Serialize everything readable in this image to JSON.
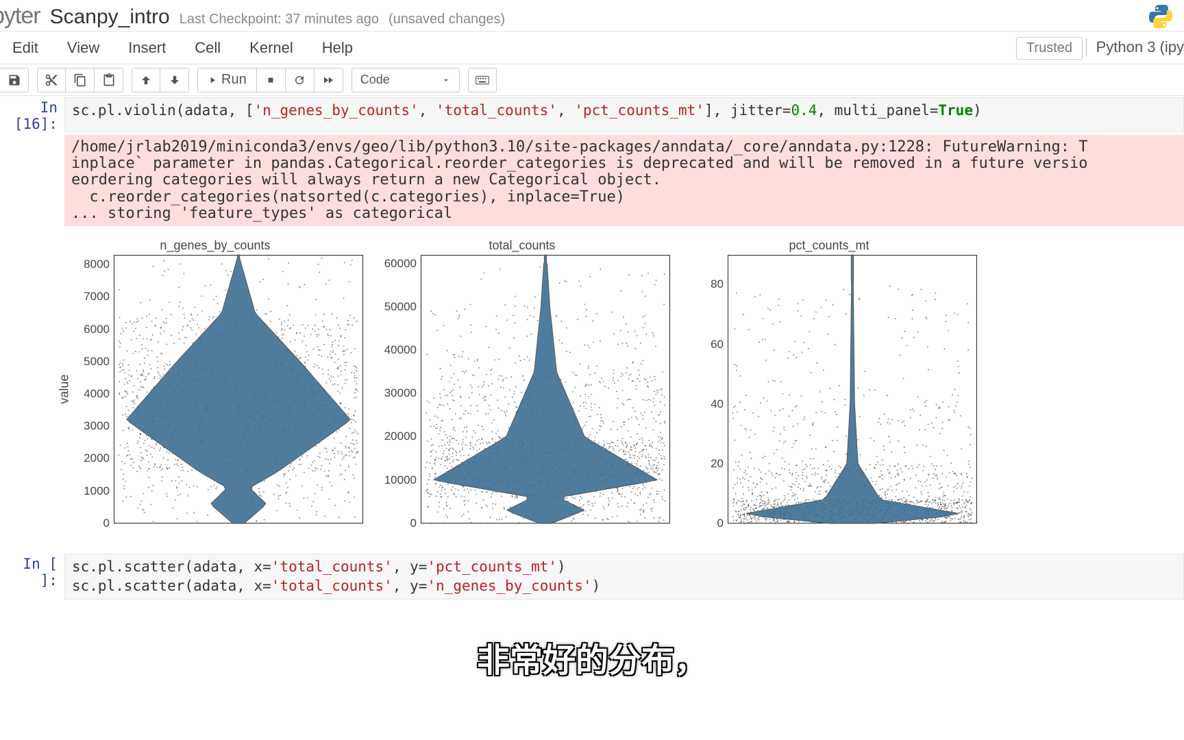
{
  "header": {
    "logo_text": "pyter",
    "notebook_name": "Scanpy_intro",
    "checkpoint": "Last Checkpoint: 37 minutes ago",
    "unsaved": "(unsaved changes)"
  },
  "menubar": {
    "items": [
      "Edit",
      "View",
      "Insert",
      "Cell",
      "Kernel",
      "Help"
    ],
    "trusted": "Trusted",
    "kernel_name": "Python 3 (ipy"
  },
  "toolbar": {
    "run_label": "Run",
    "cell_type": "Code"
  },
  "cell16": {
    "prompt": "In [16]:",
    "code_prefix": "sc.pl.violin(adata, [",
    "s1": "'n_genes_by_counts'",
    "s2": "'total_counts'",
    "s3": "'pct_counts_mt'",
    "code_mid1": "], jitter=",
    "num1": "0.4",
    "code_mid2": ", multi_panel=",
    "bool1": "True",
    "code_end": ")"
  },
  "warning_text": "/home/jrlab2019/miniconda3/envs/geo/lib/python3.10/site-packages/anndata/_core/anndata.py:1228: FutureWarning: T\ninplace` parameter in pandas.Categorical.reorder_categories is deprecated and will be removed in a future versio\neordering categories will always return a new Categorical object.\n  c.reorder_categories(natsorted(c.categories), inplace=True)\n... storing 'feature_types' as categorical",
  "chart_data": [
    {
      "type": "violin",
      "title": "n_genes_by_counts",
      "ylabel": "value",
      "ylim": [
        0,
        8300
      ],
      "yticks": [
        0,
        1000,
        2000,
        3000,
        4000,
        5000,
        6000,
        7000,
        8000
      ],
      "density_profile": [
        [
          0,
          0.05
        ],
        [
          600,
          0.25
        ],
        [
          1100,
          0.1
        ],
        [
          1600,
          0.35
        ],
        [
          3200,
          1.0
        ],
        [
          5000,
          0.55
        ],
        [
          6500,
          0.15
        ],
        [
          8200,
          0.01
        ]
      ],
      "jitter_n": 1600
    },
    {
      "type": "violin",
      "title": "total_counts",
      "ylabel": "",
      "ylim": [
        0,
        62000
      ],
      "yticks": [
        0,
        10000,
        20000,
        30000,
        40000,
        50000,
        60000
      ],
      "density_profile": [
        [
          0,
          0.05
        ],
        [
          3000,
          0.35
        ],
        [
          6000,
          0.12
        ],
        [
          10000,
          1.0
        ],
        [
          20000,
          0.35
        ],
        [
          35000,
          0.1
        ],
        [
          50000,
          0.04
        ],
        [
          60000,
          0.015
        ]
      ],
      "jitter_n": 1600
    },
    {
      "type": "violin",
      "title": "pct_counts_mt",
      "ylabel": "",
      "ylim": [
        0,
        90
      ],
      "yticks": [
        0,
        20,
        40,
        60,
        80
      ],
      "density_profile": [
        [
          0,
          0.2
        ],
        [
          3,
          1.0
        ],
        [
          8,
          0.25
        ],
        [
          20,
          0.05
        ],
        [
          40,
          0.02
        ],
        [
          80,
          0.008
        ]
      ],
      "jitter_n": 1600
    }
  ],
  "cell_next": {
    "prompt": "In [ ]:",
    "line1_a": "sc.pl.scatter(adata, x=",
    "line1_s1": "'total_counts'",
    "line1_b": ", y=",
    "line1_s2": "'pct_counts_mt'",
    "line1_c": ")",
    "line2_a": "sc.pl.scatter(adata, x=",
    "line2_s1": "'total_counts'",
    "line2_b": ", y=",
    "line2_s2": "'n_genes_by_counts'",
    "line2_c": ")"
  },
  "subtitle": "非常好的分布，",
  "colors": {
    "violin_fill": "#3d6f94",
    "violin_stroke": "#555",
    "warning_bg": "#fdd"
  }
}
